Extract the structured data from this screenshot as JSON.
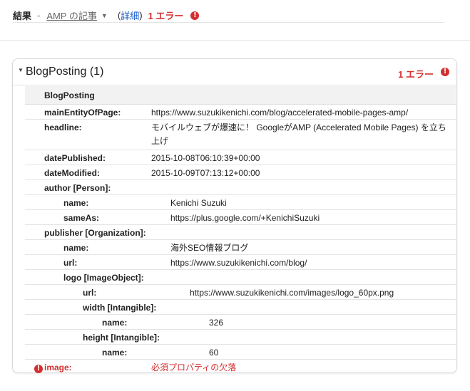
{
  "topbar": {
    "results_label": "結果",
    "separator": "-",
    "article_link": "AMP の記事",
    "paren_open": "(",
    "detail_link": "詳細",
    "paren_close": ")",
    "error_count": "1 エラー",
    "error_icon": "!"
  },
  "panel": {
    "title": "BlogPosting (1)",
    "error_count": "1 エラー",
    "error_icon": "!"
  },
  "table": {
    "type": "BlogPosting",
    "rows": [
      {
        "key": "mainEntityOfPage:",
        "value": "https://www.suzukikenichi.com/blog/accelerated-mobile-pages-amp/"
      },
      {
        "key": "headline:",
        "value": "モバイルウェブが爆速に！ GoogleがAMP (Accelerated Mobile Pages) を立ち上げ"
      },
      {
        "key": "datePublished:",
        "value": "2015-10-08T06:10:39+00:00"
      },
      {
        "key": "dateModified:",
        "value": "2015-10-09T07:13:12+00:00"
      },
      {
        "key": "author [Person]:",
        "value": ""
      },
      {
        "key": "name:",
        "value": "Kenichi Suzuki"
      },
      {
        "key": "sameAs:",
        "value": "https://plus.google.com/+KenichiSuzuki"
      },
      {
        "key": "publisher [Organization]:",
        "value": ""
      },
      {
        "key": "name:",
        "value": "海外SEO情報ブログ"
      },
      {
        "key": "url:",
        "value": "https://www.suzukikenichi.com/blog/"
      },
      {
        "key": "logo [ImageObject]:",
        "value": ""
      },
      {
        "key": "url:",
        "value": "https://www.suzukikenichi.com/images/logo_60px.png"
      },
      {
        "key": "width [Intangible]:",
        "value": ""
      },
      {
        "key": "name:",
        "value": "326"
      },
      {
        "key": "height [Intangible]:",
        "value": ""
      },
      {
        "key": "name:",
        "value": "60"
      },
      {
        "key": "image:",
        "value": "必須プロパティの欠落"
      }
    ]
  },
  "colors": {
    "error": "#d32f2f",
    "link": "#1155cc",
    "type_header_bg": "#f2f2f2"
  }
}
